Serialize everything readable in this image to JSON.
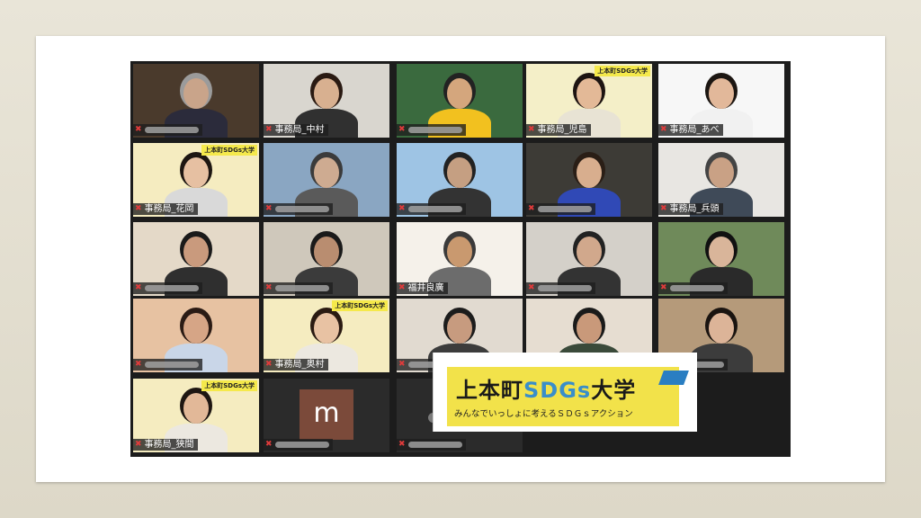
{
  "grid": {
    "tiles": [
      {
        "name": "",
        "bg": "#4a3a2c",
        "skin": "#c9a48a",
        "shirt": "#2b2b3b",
        "hair": "#9b9b9b"
      },
      {
        "name": "事務局_中村",
        "bg": "#d9d6cf",
        "skin": "#d8b090",
        "shirt": "#303030",
        "hair": "#2a1a12"
      },
      {
        "name": "",
        "bg": "#3a6a3e",
        "skin": "#d4a67d",
        "shirt": "#f2c11f",
        "hair": "#222"
      },
      {
        "name": "事務局_児島",
        "bg": "#f4efc8",
        "skin": "#e3b997",
        "shirt": "#e8e3d4",
        "hair": "#1d1411",
        "banner": "上本町SDGs大学",
        "active": true
      },
      {
        "name": "事務局_あべ",
        "bg": "#f7f7f7",
        "skin": "#e2b89a",
        "shirt": "#f1f1f1",
        "hair": "#1c1612"
      },
      {
        "name": "事務局_花岡",
        "bg": "#f5ecc0",
        "skin": "#e6c0a2",
        "shirt": "#d9d9d9",
        "hair": "#1d1612",
        "banner": "上本町SDGs大学"
      },
      {
        "name": "",
        "bg": "#8aa6c2",
        "skin": "#ceab91",
        "shirt": "#5a5a5a",
        "hair": "#3b3b3b"
      },
      {
        "name": "",
        "bg": "#9ec4e4",
        "skin": "#c59f82",
        "shirt": "#333",
        "hair": "#222"
      },
      {
        "name": "",
        "bg": "#3d3b36",
        "skin": "#d8ae8e",
        "shirt": "#3049b6",
        "hair": "#2a1e16"
      },
      {
        "name": "事務局_兵頭",
        "bg": "#e8e6e2",
        "skin": "#c9a185",
        "shirt": "#3f4a58",
        "hair": "#444"
      },
      {
        "name": "",
        "bg": "#e4d9c8",
        "skin": "#c99a7d",
        "shirt": "#2f2f2f",
        "hair": "#1a1a1a"
      },
      {
        "name": "",
        "bg": "#cfc8bb",
        "skin": "#b98d70",
        "shirt": "#3b3b3b",
        "hair": "#1a1a1a"
      },
      {
        "name": "福井良廣",
        "bg": "#f5f1ea",
        "skin": "#c9996f",
        "shirt": "#6c6c6c",
        "hair": "#3a3a3a",
        "speaking": true
      },
      {
        "name": "",
        "bg": "#d4d0c9",
        "skin": "#d1a88c",
        "shirt": "#333",
        "hair": "#222"
      },
      {
        "name": "",
        "bg": "#6f8a5a",
        "skin": "#d9b59a",
        "shirt": "#2a2a2a",
        "hair": "#111"
      },
      {
        "name": "",
        "bg": "#e7c2a2",
        "skin": "#d6a586",
        "shirt": "#c9d6e8",
        "hair": "#2a1a14"
      },
      {
        "name": "事務局_奥村",
        "bg": "#f5ecc0",
        "skin": "#e8c2a3",
        "shirt": "#ece8e0",
        "hair": "#2a1a12",
        "banner": "上本町SDGs大学"
      },
      {
        "name": "",
        "bg": "#e1dad0",
        "skin": "#c79b7f",
        "shirt": "#3c3c3c",
        "hair": "#1c1c1c"
      },
      {
        "name": "",
        "bg": "#e6ddd1",
        "skin": "#c9997a",
        "shirt": "#3a4a3a",
        "hair": "#1a1a1a"
      },
      {
        "name": "",
        "bg": "#b59a7a",
        "skin": "#dcb498",
        "shirt": "#3c3c3c",
        "hair": "#1a1410"
      },
      {
        "name": "事務局_狭間",
        "bg": "#f5ecc0",
        "skin": "#e2b898",
        "shirt": "#ece8e0",
        "hair": "#1e1612",
        "banner": "上本町SDGs大学"
      },
      {
        "name": "",
        "type": "avatar",
        "letter": "m"
      },
      {
        "name": "",
        "type": "blank"
      }
    ]
  },
  "brand": {
    "title_black": "上本町",
    "title_color": "SDGs",
    "title_tail": "大学",
    "subtitle": "みんなでいっしょに考えるＳＤＧｓアクション"
  },
  "colors": {
    "brand_yellow": "#f2e24a",
    "active_outline": "#f0de2d",
    "mic_muted": "#e03b3b"
  }
}
